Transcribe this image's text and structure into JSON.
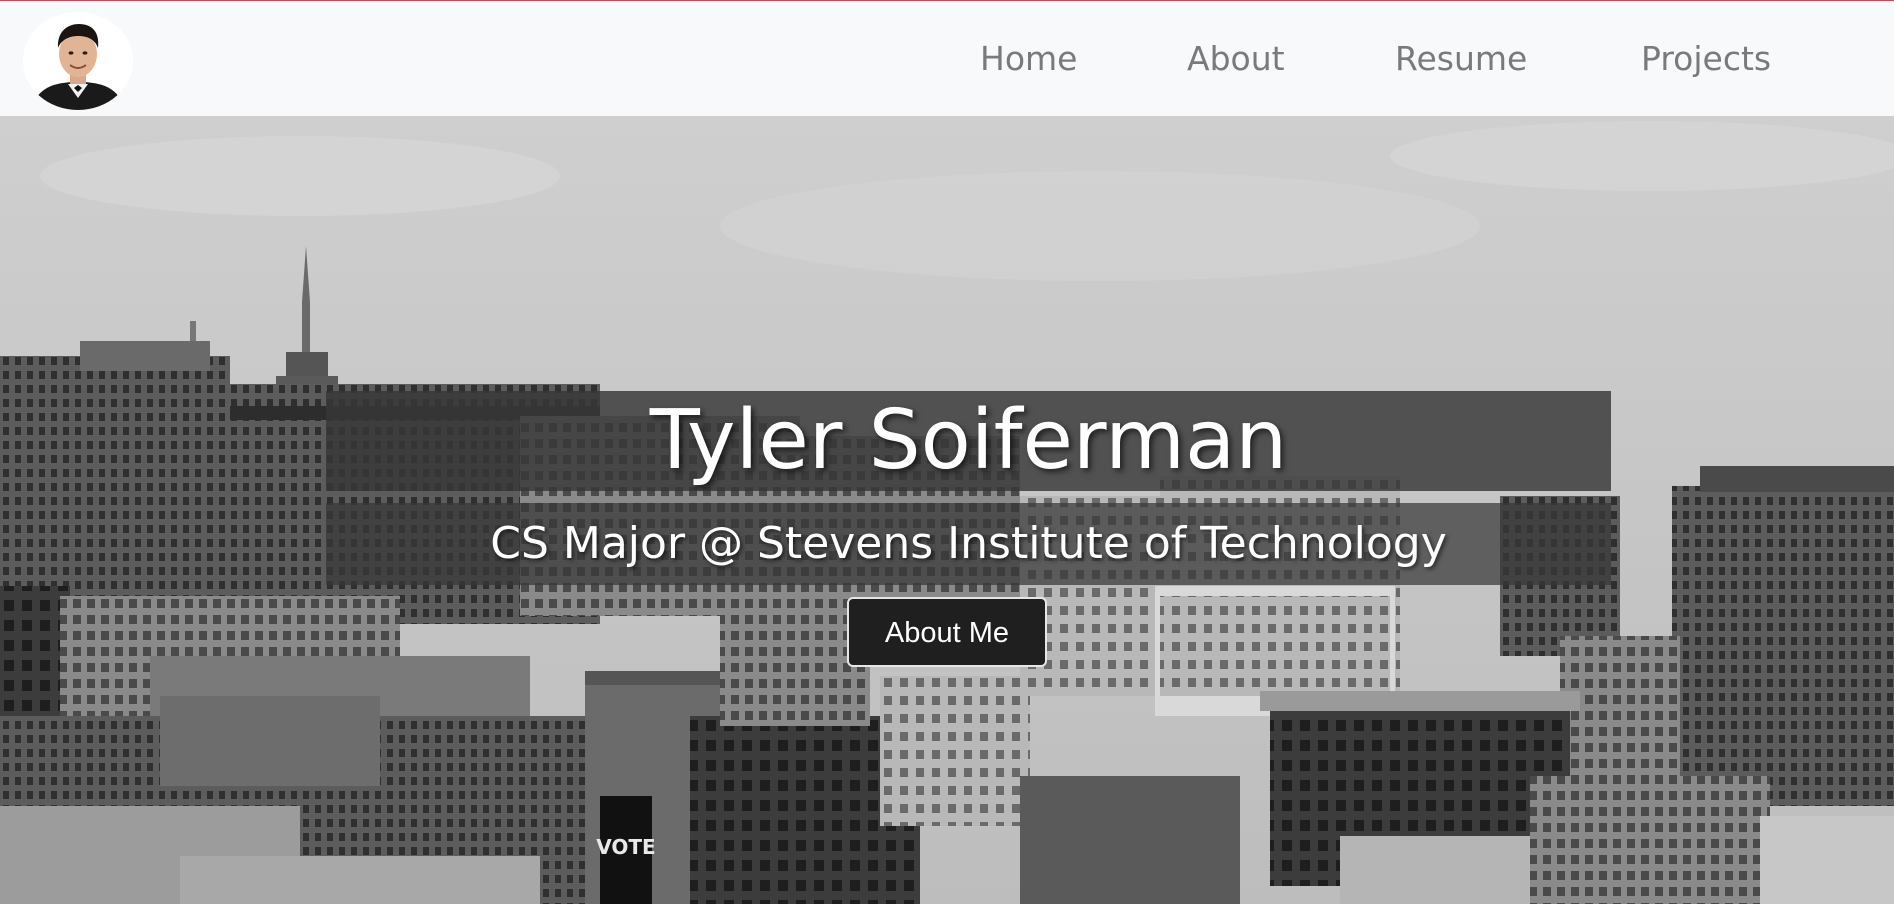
{
  "nav": {
    "links": [
      {
        "label": "Home"
      },
      {
        "label": "About"
      },
      {
        "label": "Resume"
      },
      {
        "label": "Projects"
      }
    ]
  },
  "hero": {
    "title": "Tyler Soiferman",
    "subtitle": "CS Major @ Stevens Institute of Technology",
    "button_label": "About Me",
    "sign_text": "VOTE"
  },
  "colors": {
    "nav_background": "#f8f9fa",
    "nav_link": "#7a7a7a",
    "top_border": "#c94a55",
    "band": "#373737",
    "button": "#1f1f1f"
  }
}
